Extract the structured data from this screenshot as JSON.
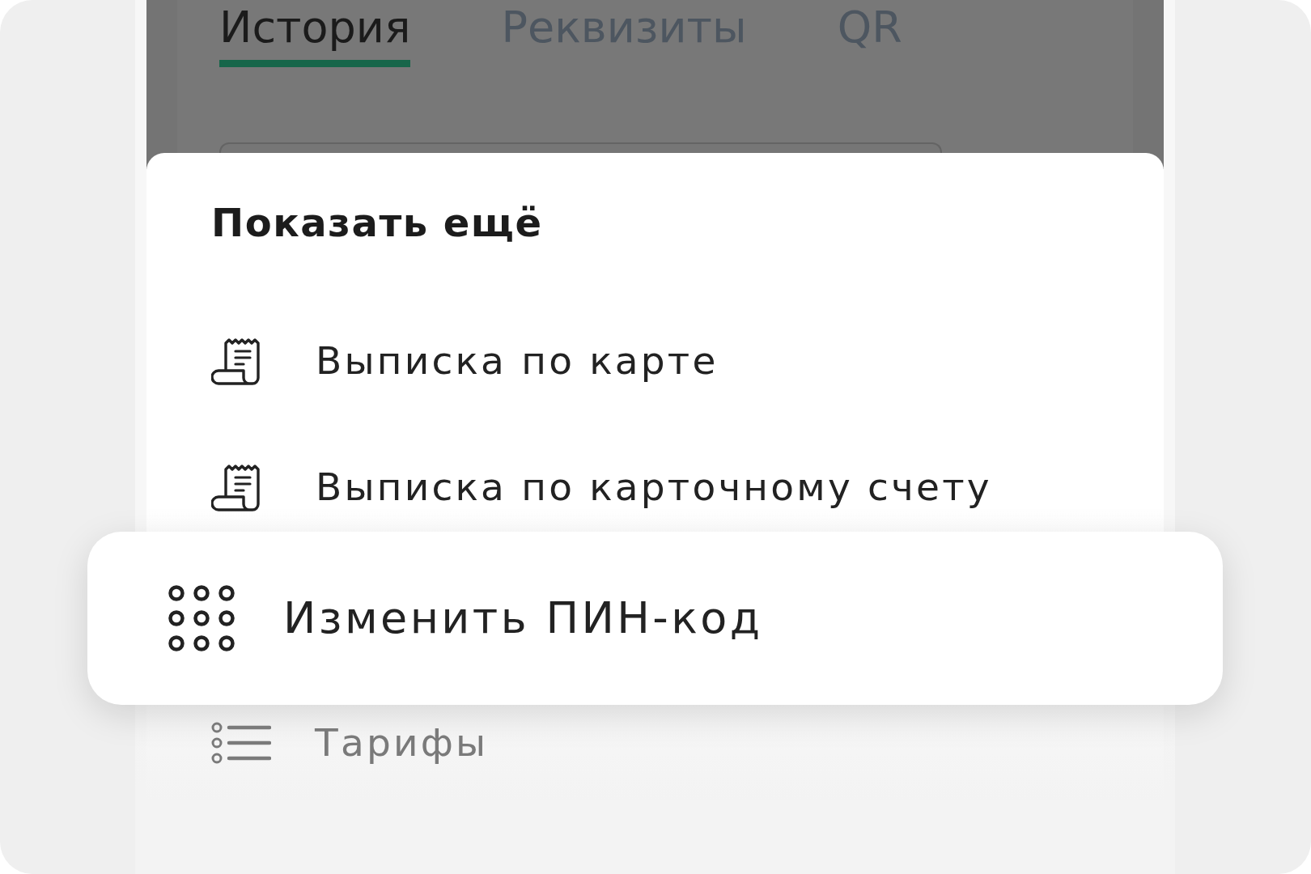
{
  "tabs": [
    {
      "label": "История",
      "selected": true
    },
    {
      "label": "Реквизиты",
      "selected": false
    },
    {
      "label": "QR",
      "selected": false
    }
  ],
  "sheet": {
    "title": "Показать ещё",
    "items": [
      {
        "kind": "statement",
        "label": "Выписка по карте",
        "selected": false
      },
      {
        "kind": "statement",
        "label": "Выписка по карточному счету",
        "selected": false
      },
      {
        "kind": "pin",
        "label": "Изменить ПИН-код",
        "selected": true
      },
      {
        "kind": "tariffs",
        "label": "Тарифы",
        "selected": false
      }
    ]
  }
}
